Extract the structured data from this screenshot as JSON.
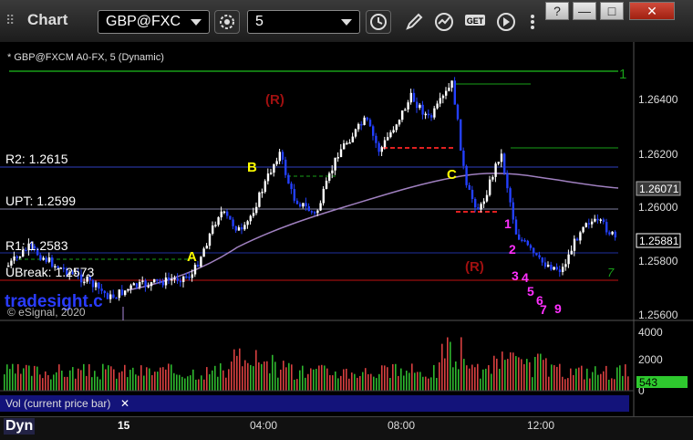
{
  "app": {
    "title": "Chart"
  },
  "toolbar": {
    "symbol": "GBP@FXC",
    "interval": "5"
  },
  "window_buttons": [
    "?",
    "—",
    "□",
    "✕"
  ],
  "chart": {
    "symbol_label": "* GBP@FXCM A0-FX, 5 (Dynamic)",
    "levels": {
      "r2": "R2: 1.2615",
      "upt": "UPT: 1.2599",
      "r1": "R1: 1.2583",
      "ubreak": "UBreak: 1.2573"
    },
    "price_axis": [
      "1.26400",
      "1.26200",
      "1.26000",
      "1.25800",
      "1.25600"
    ],
    "price_tags": {
      "purple": "1.26071",
      "current": "1.25881"
    },
    "annotations": {
      "a": "A",
      "b": "B",
      "c": "C",
      "r_top": "(R)",
      "r_bottom": "(R)",
      "one_right": "1",
      "seq_1": "1",
      "seq_2": "2",
      "seq_3": "3",
      "seq_4": "4",
      "seq_5": "5",
      "seq_6": "6",
      "seq_7": "7",
      "seq_9": "9",
      "seq_7g": "7"
    },
    "watermark": "tradesight.c",
    "copyright": "© eSignal, 2020",
    "colors": {
      "up_candle": "#ffffff",
      "down_candle": "#2340ff",
      "r2_line": "#3040c0",
      "r1_line": "#2030a0",
      "ubreak_line": "#c01010",
      "green_line": "#18a018",
      "ma_line": "#a080c0"
    }
  },
  "volume": {
    "label": "Vol (current price bar)",
    "axis": [
      "4000",
      "2000",
      "0"
    ],
    "current": "543"
  },
  "time_axis": [
    "15",
    "04:00",
    "08:00",
    "12:00"
  ],
  "bottom": {
    "dyn": "Dyn"
  }
}
